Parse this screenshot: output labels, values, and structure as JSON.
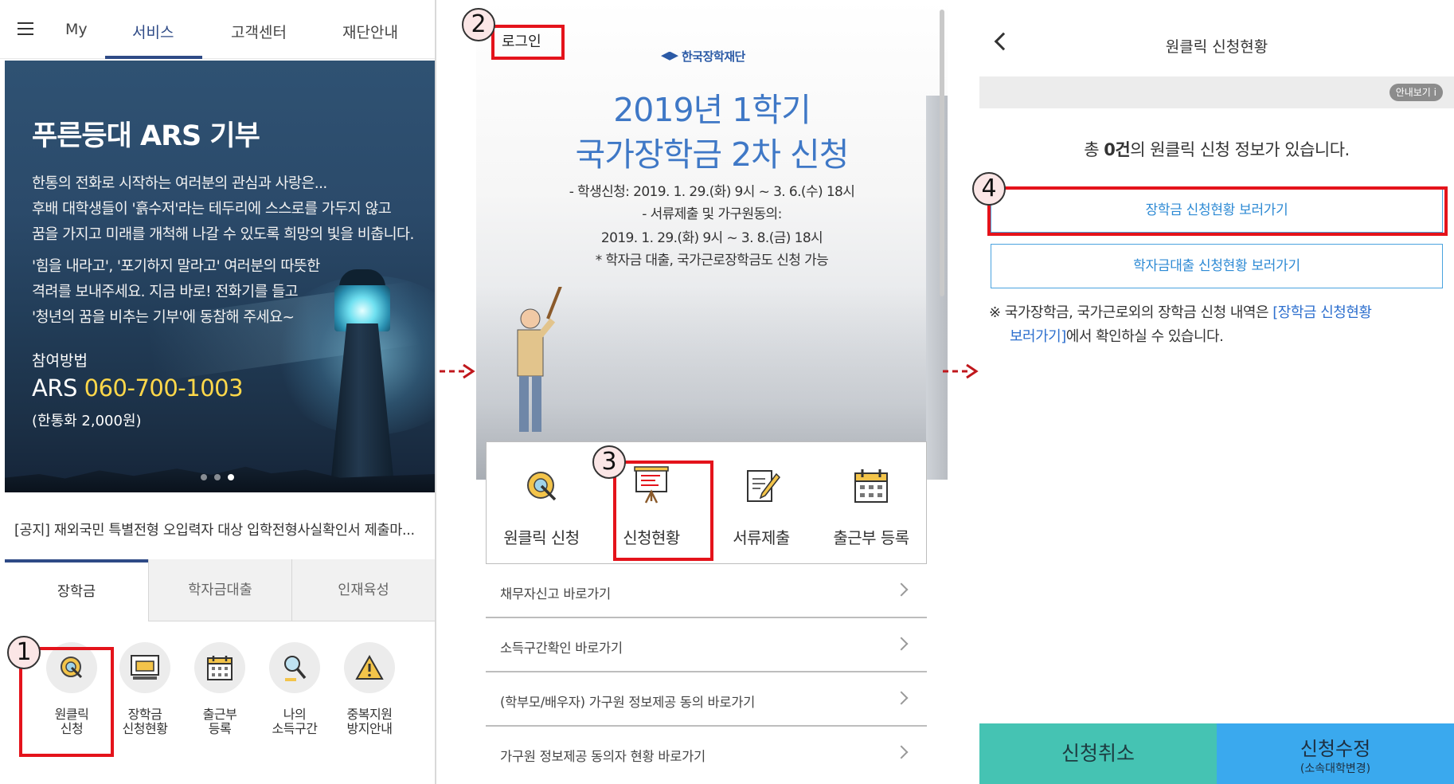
{
  "panel1": {
    "nav": [
      "My",
      "서비스",
      "고객센터",
      "재단안내"
    ],
    "banner": {
      "title": "푸른등대 ARS 기부",
      "lines": [
        "한통의 전화로 시작하는 여러분의 관심과 사랑은...",
        "후배 대학생들이 '흙수저'라는 테두리에 스스로를 가두지 않고",
        "꿈을 가지고 미래를 개척해 나갈 수 있도록 희망의 빛을 비춥니다.",
        "'힘을 내라고', '포기하지 말라고' 여러분의 따뜻한",
        "격려를 보내주세요. 지금 바로! 전화기를 들고",
        "'청년의 꿈을 비추는 기부'에 동참해 주세요~"
      ],
      "how_label": "참여방법",
      "ars_prefix": "ARS",
      "ars_number": "060-700-1003",
      "fee": "(한통화 2,000원)"
    },
    "notice": "[공지] 재외국민 특별전형 오입력자 대상 입학전형사실확인서 제출마...",
    "tabs": [
      "장학금",
      "학자금대출",
      "인재육성"
    ],
    "quick": [
      {
        "label": "원클릭\n신청",
        "icon": "one-click-icon"
      },
      {
        "label": "장학금\n신청현황",
        "icon": "scholarship-status-icon"
      },
      {
        "label": "출근부\n등록",
        "icon": "calendar-icon"
      },
      {
        "label": "나의\n소득구간",
        "icon": "income-search-icon"
      },
      {
        "label": "중복지원\n방지안내",
        "icon": "warning-icon"
      }
    ]
  },
  "panel2": {
    "login": "로그인",
    "logo": "한국장학재단",
    "title1": "2019년 1학기",
    "title2": "국가장학금 2차 신청",
    "desc": [
      "- 학생신청: 2019. 1. 29.(화) 9시 ~ 3. 6.(수) 18시",
      "- 서류제출 및 가구원동의:",
      "2019. 1. 29.(화) 9시 ~ 3. 8.(금) 18시",
      "* 학자금 대출, 국가근로장학금도 신청 가능"
    ],
    "menu": [
      {
        "label": "원클릭 신청",
        "icon": "one-click-icon"
      },
      {
        "label": "신청현황",
        "icon": "easel-chart-icon"
      },
      {
        "label": "서류제출",
        "icon": "document-pen-icon"
      },
      {
        "label": "출근부 등록",
        "icon": "calendar-icon"
      }
    ],
    "links": [
      "채무자신고 바로가기",
      "소득구간확인 바로가기",
      "(학부모/배우자) 가구원 정보제공 동의 바로가기",
      "가구원 정보제공 동의자 현황 바로가기"
    ]
  },
  "panel3": {
    "title": "원클릭 신청현황",
    "guide": "안내보기 i",
    "count_prefix": "총 ",
    "count_value": "0건",
    "count_suffix": "의 원클릭 신청 정보가 있습니다.",
    "btn_scholarship": "장학금 신청현황 보러가기",
    "btn_loan": "학자금대출 신청현황 보러가기",
    "note_a": "※ 국가장학금, 국가근로외의 장학금 신청 내역은 ",
    "note_link1": "[장학금 신청현황",
    "note_link2": "보러가기]",
    "note_b": "에서 확인하실 수 있습니다.",
    "cancel": "신청취소",
    "edit": "신청수정",
    "edit_sub": "(소속대학변경)"
  },
  "markers": [
    "1",
    "2",
    "3",
    "4"
  ],
  "colors": {
    "highlight": "#e4131b",
    "brand": "#2e4a86",
    "accent_blue": "#3f78c6",
    "cancel_bg": "#45c3b3",
    "edit_bg": "#3aa9ee"
  }
}
